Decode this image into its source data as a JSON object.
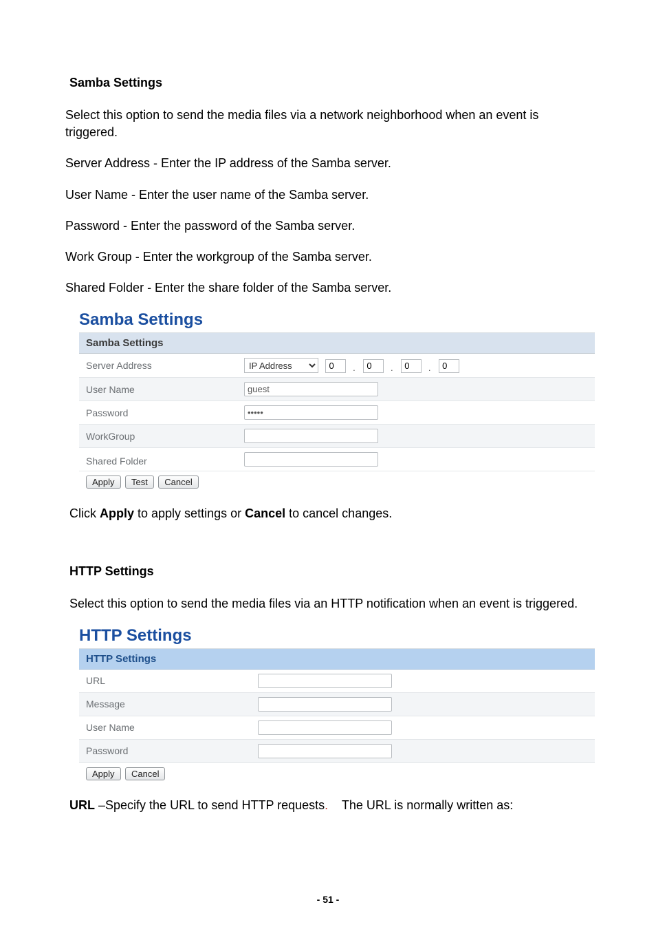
{
  "samba": {
    "heading": "Samba Settings",
    "intro": "Select this option to send the media files via a network neighborhood when an event is triggered.",
    "desc_server": "Server Address - Enter the IP address of the Samba server.",
    "desc_user": "User Name - Enter the user name of the Samba server.",
    "desc_password": "Password - Enter the password of the Samba server.",
    "desc_workgroup": "Work Group - Enter the workgroup of the Samba server.",
    "desc_shared": "Shared Folder - Enter the share folder of the Samba server.",
    "panel_title": "Samba Settings",
    "panel_header": "Samba Settings",
    "labels": {
      "server_address": "Server Address",
      "user_name": "User Name",
      "password": "Password",
      "workgroup": "WorkGroup",
      "shared_folder": "Shared Folder"
    },
    "addr_type_selected": "IP Address",
    "octets": [
      "0",
      "0",
      "0",
      "0"
    ],
    "user_name_value": "guest",
    "password_value": "•••••",
    "workgroup_value": "",
    "shared_folder_value": "",
    "buttons": {
      "apply": "Apply",
      "test": "Test",
      "cancel": "Cancel"
    },
    "apply_cancel_text_pre": "Click ",
    "apply_cancel_bold1": "Apply",
    "apply_cancel_mid": " to apply settings or ",
    "apply_cancel_bold2": "Cancel",
    "apply_cancel_post": " to cancel changes."
  },
  "http": {
    "heading": "HTTP Settings",
    "intro": "Select this option to send the media files via an HTTP notification when an event is triggered.",
    "panel_title": "HTTP Settings",
    "panel_header": "HTTP Settings",
    "labels": {
      "url": "URL",
      "message": "Message",
      "user_name": "User Name",
      "password": "Password"
    },
    "url_value": "",
    "message_value": "",
    "user_name_value": "",
    "password_value": "",
    "buttons": {
      "apply": "Apply",
      "cancel": "Cancel"
    },
    "url_desc_bold": "URL",
    "url_desc_rest_1": " –Specify the URL to send HTTP requests",
    "url_desc_rest_2": ".    The URL is normally written as:"
  },
  "page_number": "- 51 -"
}
